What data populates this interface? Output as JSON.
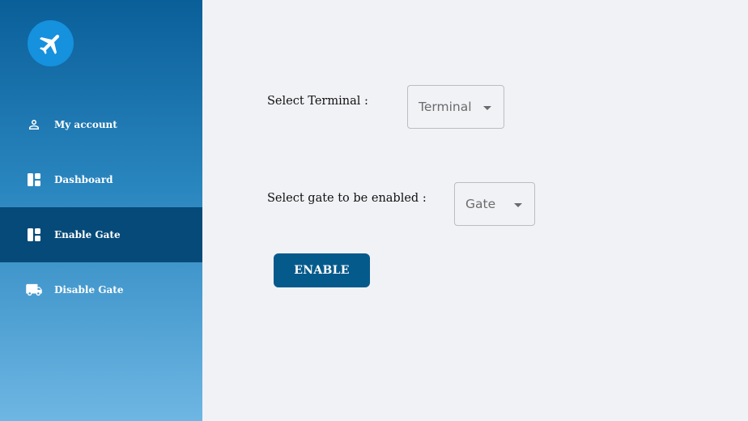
{
  "sidebar": {
    "logo_icon": "airplane-icon",
    "items": [
      {
        "label": "My account",
        "icon": "person-icon",
        "active": false
      },
      {
        "label": "Dashboard",
        "icon": "dashboard-icon",
        "active": false
      },
      {
        "label": "Enable Gate",
        "icon": "dashboard-icon",
        "active": true
      },
      {
        "label": "Disable Gate",
        "icon": "truck-icon",
        "active": false
      }
    ]
  },
  "form": {
    "terminal_label": "Select Terminal :",
    "terminal_value": "Terminal",
    "gate_label": "Select gate to be enabled :",
    "gate_value": "Gate",
    "submit_label": "ENABLE"
  },
  "colors": {
    "sidebar_top": "#0a5f99",
    "sidebar_bottom": "#6eb6e3",
    "active_item": "#054a78",
    "button": "#055a8c",
    "background": "#f1f2f6",
    "logo_circle": "#1591de"
  }
}
